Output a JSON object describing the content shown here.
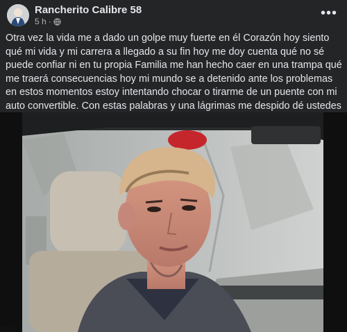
{
  "post": {
    "author": "Rancherito Calibre 58",
    "time": "5 h",
    "separator": "·",
    "privacy_icon": "globe-icon",
    "more_icon": "more-options-icon",
    "more_label": "•••",
    "text": "Otra vez la vida me a dado un golpe muy fuerte en él Corazón hoy siento qué mi vida y  mi carrera a llegado a su fin hoy me doy cuenta qué no sé puede confiar ni en tu  propia Familia me han hecho caer en una trampa qué me traerá consecuencias hoy mi mundo se a detenido ante los problemas en estos momentos estoy intentando chocar o tirarme de un puente con mi  auto convertible. Con estas palabras y una lágrimas me despido dé ustedes 😭"
  },
  "colors": {
    "background": "#242526",
    "text": "#e4e6eb",
    "secondary_text": "#b0b3b8"
  }
}
